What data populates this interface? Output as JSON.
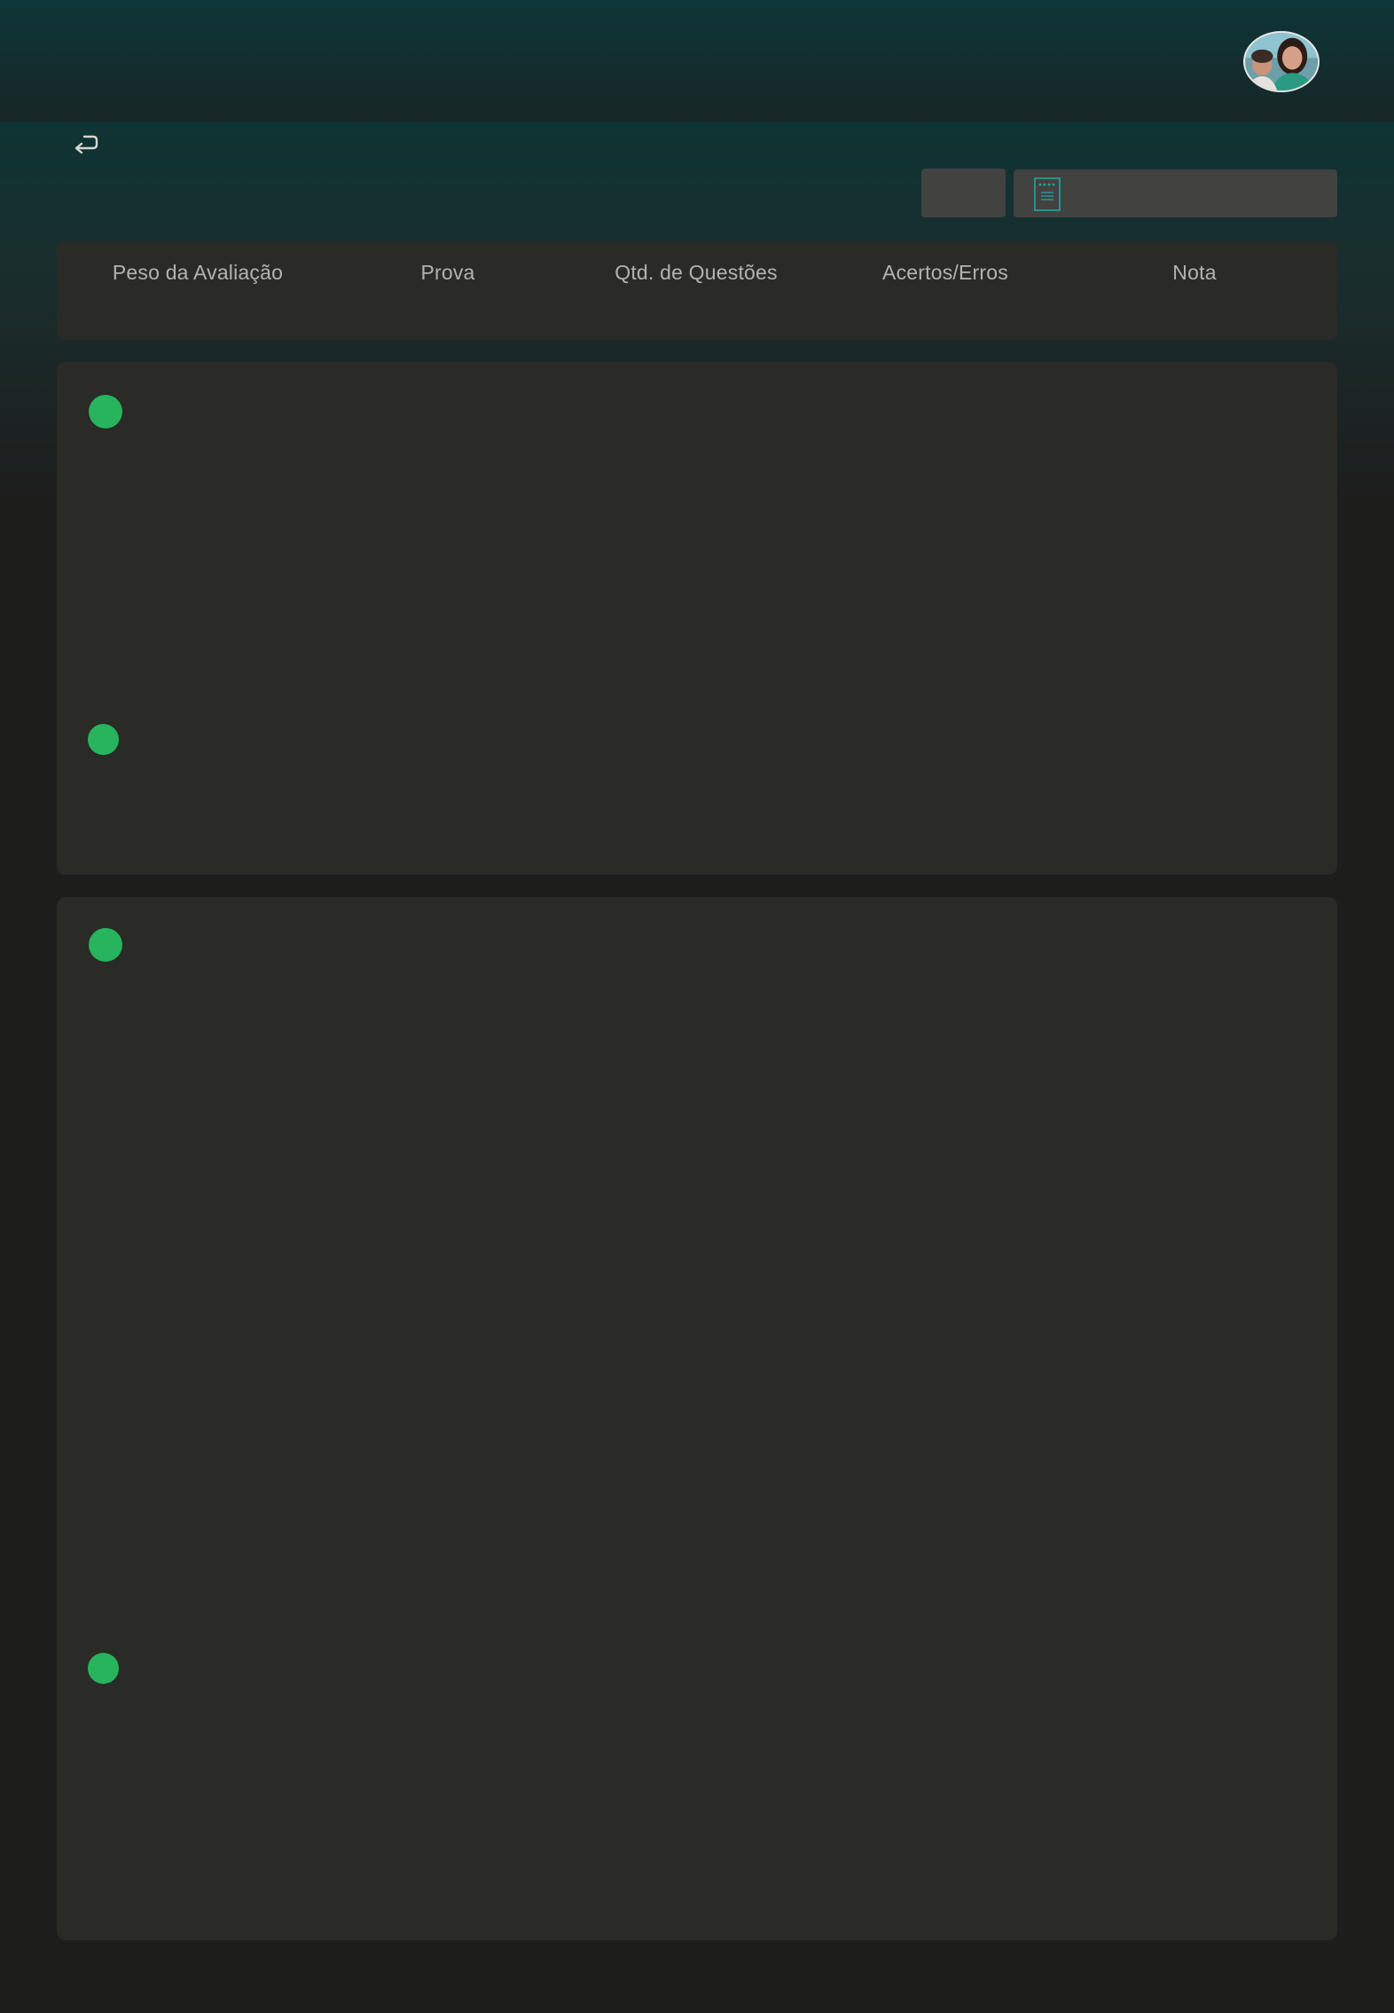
{
  "header": {
    "avatar_icon": "user-avatar"
  },
  "toolbar": {
    "back_icon": "back-arrow-icon",
    "doc_icon": "document-icon"
  },
  "table": {
    "columns": [
      "Peso da Avaliação",
      "Prova",
      "Qtd. de Questões",
      "Acertos/Erros",
      "Nota"
    ]
  },
  "colors": {
    "accent_green": "#27b45d",
    "accent_teal": "#1fa6a0",
    "header_bg": "#0e3638",
    "card_bg": "#2a2a27",
    "page_bg": "#1d1d1c"
  }
}
